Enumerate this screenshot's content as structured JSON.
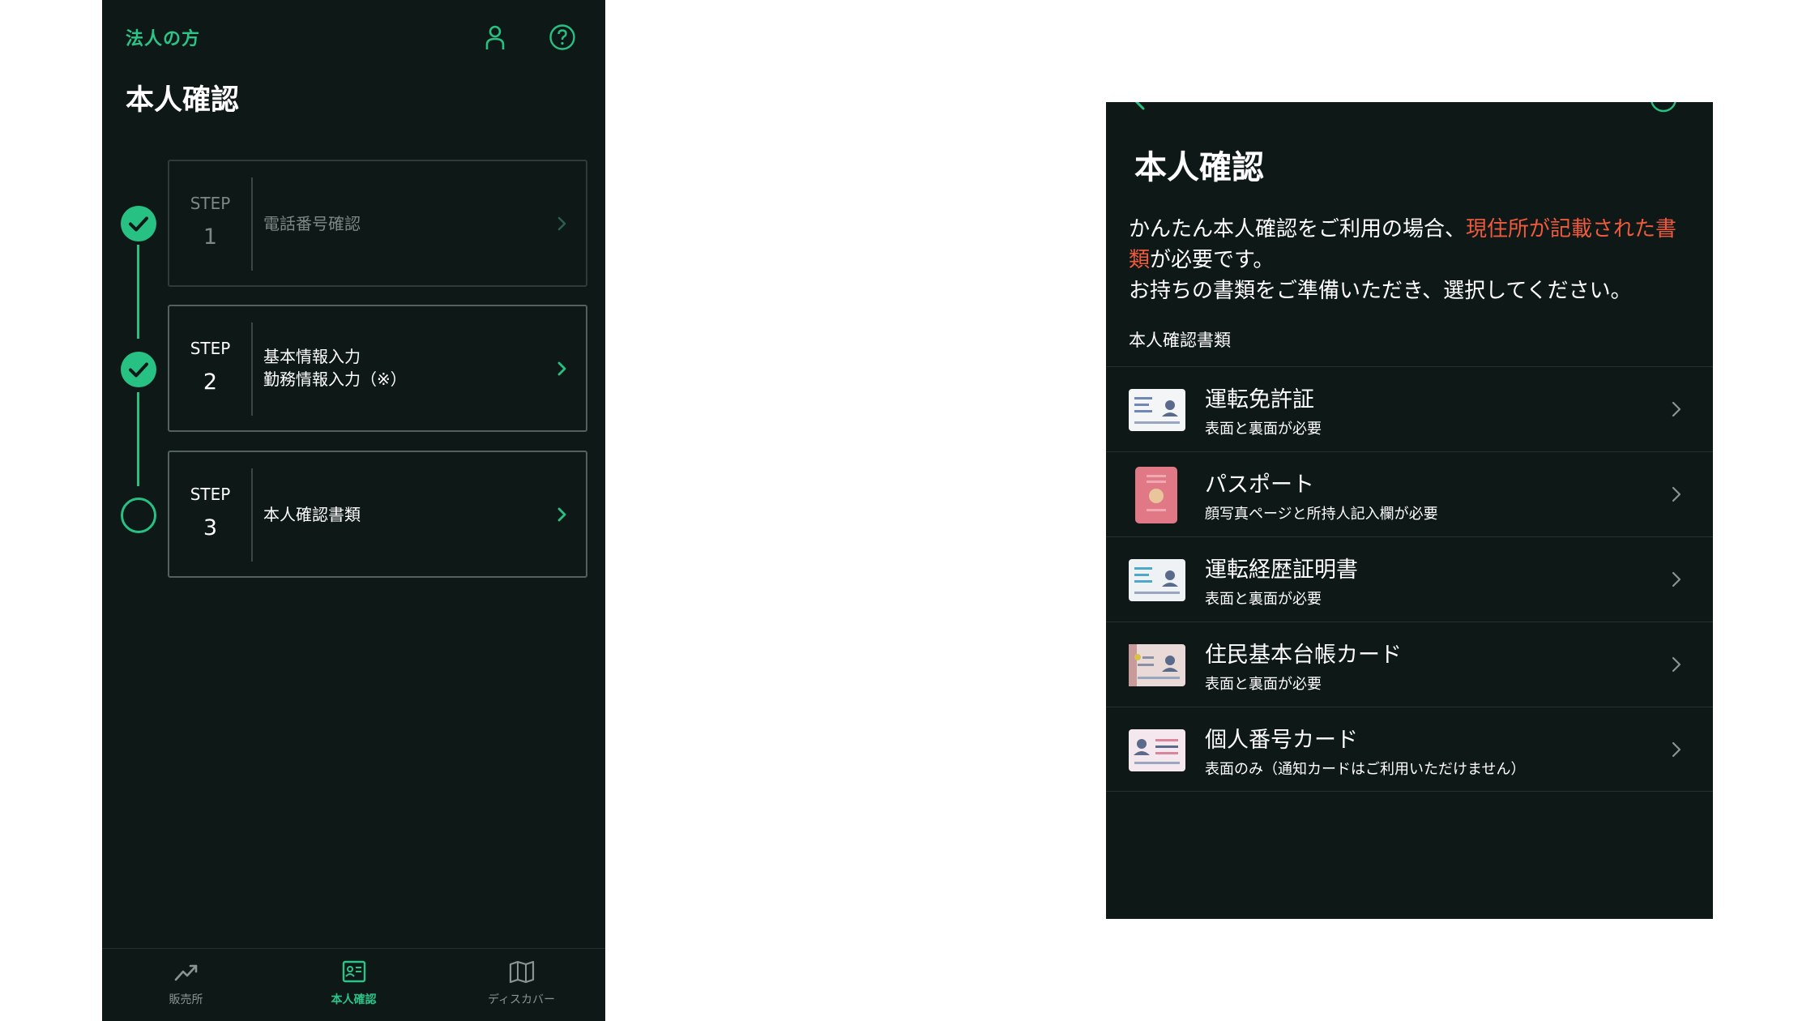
{
  "left": {
    "header_link": "法人の方",
    "title": "本人確認",
    "steps": [
      {
        "word": "STEP",
        "number": "1",
        "label_lines": [
          "電話番号確認"
        ],
        "status": "done",
        "enabled": false
      },
      {
        "word": "STEP",
        "number": "2",
        "label_lines": [
          "基本情報入力",
          "勤務情報入力（※）"
        ],
        "status": "done",
        "enabled": true
      },
      {
        "word": "STEP",
        "number": "3",
        "label_lines": [
          "本人確認書類"
        ],
        "status": "todo",
        "enabled": true
      }
    ],
    "tabs": [
      {
        "label": "販売所",
        "icon": "trend-chart-icon",
        "active": false
      },
      {
        "label": "本人確認",
        "icon": "id-card-icon",
        "active": true
      },
      {
        "label": "ディスカバー",
        "icon": "map-icon",
        "active": false
      }
    ]
  },
  "right": {
    "title": "本人確認",
    "intro_part1": "かんたん本人確認をご利用の場合、",
    "intro_highlight": "現住所が記載された書類",
    "intro_part2": "が必要です。",
    "intro_line2": "お持ちの書類をご準備いただき、選択してください。",
    "docs_heading": "本人確認書類",
    "documents": [
      {
        "name": "運転免許証",
        "desc": "表面と裏面が必要",
        "icon": "drivers-license-icon"
      },
      {
        "name": "パスポート",
        "desc": "顔写真ページと所持人記入欄が必要",
        "icon": "passport-icon"
      },
      {
        "name": "運転経歴証明書",
        "desc": "表面と裏面が必要",
        "icon": "driving-history-certificate-icon"
      },
      {
        "name": "住民基本台帳カード",
        "desc": "表面と裏面が必要",
        "icon": "resident-registry-card-icon"
      },
      {
        "name": "個人番号カード",
        "desc": "表面のみ（通知カードはご利用いただけません）",
        "icon": "my-number-card-icon"
      }
    ]
  },
  "colors": {
    "background": "#0e1817",
    "accent": "#27c183",
    "highlight": "#f05a3c"
  }
}
